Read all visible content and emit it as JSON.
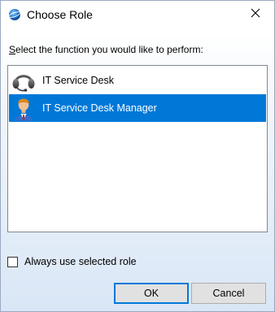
{
  "window": {
    "title": "Choose Role",
    "icon": "app-globe-icon",
    "close_icon": "close-icon"
  },
  "prompt": {
    "accelerator": "S",
    "rest": "elect the function you would like to perform:"
  },
  "roles": [
    {
      "label": "IT Service Desk",
      "icon": "headset-icon",
      "selected": false
    },
    {
      "label": "IT Service Desk Manager",
      "icon": "manager-person-icon",
      "selected": true
    }
  ],
  "always_use": {
    "label": "Always use selected role",
    "checked": false
  },
  "buttons": {
    "ok": "OK",
    "cancel": "Cancel"
  },
  "colors": {
    "selection": "#0078d7",
    "default_button_border": "#0078d7"
  }
}
